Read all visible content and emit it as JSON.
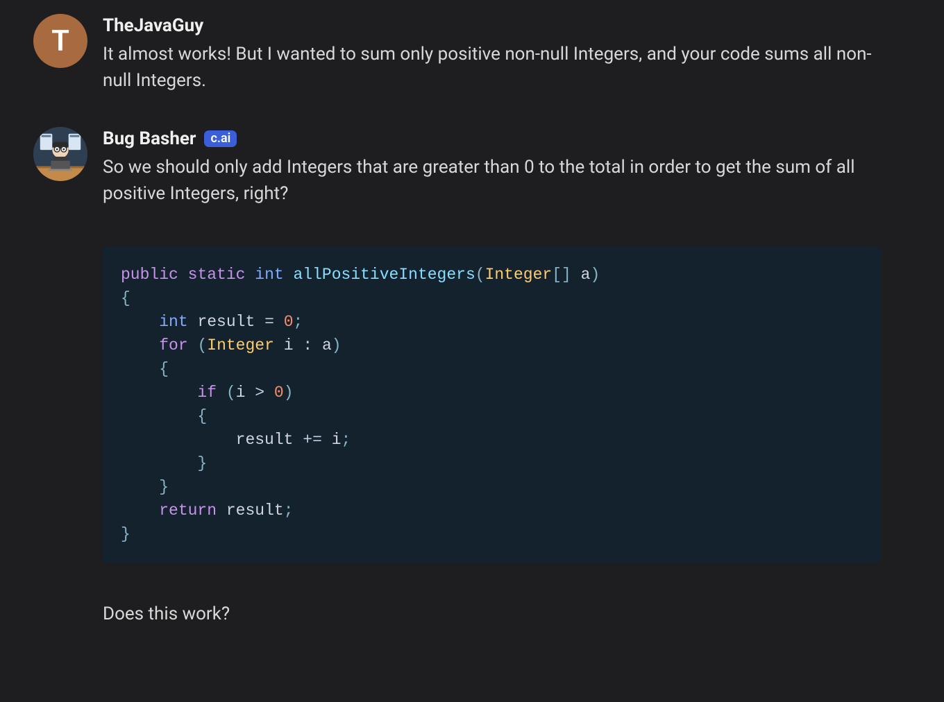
{
  "messages": [
    {
      "avatar_letter": "T",
      "username": "TheJavaGuy",
      "badge": null,
      "text": "It almost works! But I wanted to sum only positive non-null Integers, and your code sums all non-null Integers."
    },
    {
      "avatar_letter": null,
      "username": "Bug Basher",
      "badge": "c.ai",
      "text_before_code": "So we should only add Integers that are greater than 0 to the total in order to get the sum of all positive Integers, right?",
      "code": {
        "language": "java",
        "tokens": [
          [
            [
              "kw",
              "public"
            ],
            [
              "sp",
              " "
            ],
            [
              "kw",
              "static"
            ],
            [
              "sp",
              " "
            ],
            [
              "type",
              "int"
            ],
            [
              "sp",
              " "
            ],
            [
              "fn",
              "allPositiveIntegers"
            ],
            [
              "pn",
              "("
            ],
            [
              "cls",
              "Integer"
            ],
            [
              "pn",
              "[]"
            ],
            [
              "sp",
              " "
            ],
            [
              "var",
              "a"
            ],
            [
              "pn",
              ")"
            ]
          ],
          [
            [
              "pn",
              "{"
            ]
          ],
          [
            [
              "sp",
              "    "
            ],
            [
              "type",
              "int"
            ],
            [
              "sp",
              " "
            ],
            [
              "var",
              "result"
            ],
            [
              "sp",
              " "
            ],
            [
              "op",
              "="
            ],
            [
              "sp",
              " "
            ],
            [
              "num",
              "0"
            ],
            [
              "pn",
              ";"
            ]
          ],
          [
            [
              "sp",
              "    "
            ],
            [
              "kw",
              "for"
            ],
            [
              "sp",
              " "
            ],
            [
              "pn",
              "("
            ],
            [
              "cls",
              "Integer"
            ],
            [
              "sp",
              " "
            ],
            [
              "var",
              "i"
            ],
            [
              "sp",
              " "
            ],
            [
              "op",
              ":"
            ],
            [
              "sp",
              " "
            ],
            [
              "var",
              "a"
            ],
            [
              "pn",
              ")"
            ]
          ],
          [
            [
              "sp",
              "    "
            ],
            [
              "pn",
              "{"
            ]
          ],
          [
            [
              "sp",
              "        "
            ],
            [
              "kw",
              "if"
            ],
            [
              "sp",
              " "
            ],
            [
              "pn",
              "("
            ],
            [
              "var",
              "i"
            ],
            [
              "sp",
              " "
            ],
            [
              "op",
              ">"
            ],
            [
              "sp",
              " "
            ],
            [
              "num",
              "0"
            ],
            [
              "pn",
              ")"
            ]
          ],
          [
            [
              "sp",
              "        "
            ],
            [
              "pn",
              "{"
            ]
          ],
          [
            [
              "sp",
              "            "
            ],
            [
              "var",
              "result"
            ],
            [
              "sp",
              " "
            ],
            [
              "op",
              "+="
            ],
            [
              "sp",
              " "
            ],
            [
              "var",
              "i"
            ],
            [
              "pn",
              ";"
            ]
          ],
          [
            [
              "sp",
              "        "
            ],
            [
              "pn",
              "}"
            ]
          ],
          [
            [
              "sp",
              "    "
            ],
            [
              "pn",
              "}"
            ]
          ],
          [
            [
              "sp",
              "    "
            ],
            [
              "kw",
              "return"
            ],
            [
              "sp",
              " "
            ],
            [
              "var",
              "result"
            ],
            [
              "pn",
              ";"
            ]
          ],
          [
            [
              "pn",
              "}"
            ]
          ]
        ]
      },
      "text_after_code": "Does this work?"
    }
  ]
}
